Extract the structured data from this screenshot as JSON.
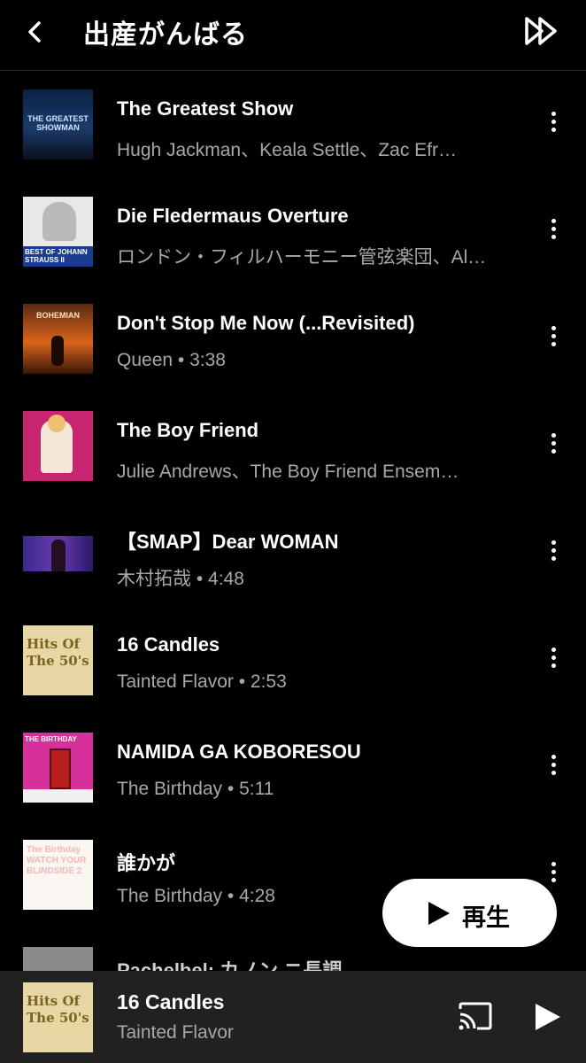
{
  "header": {
    "title": "出産がんばる",
    "back_icon": "chevron-left-icon",
    "skip_icon": "skip-forward-icon"
  },
  "tracks": [
    {
      "title": "The Greatest Show",
      "subtitle": "Hugh Jackman、Keala Settle、Zac Efr…",
      "thumb_text": "THE GREATEST SHOWMAN"
    },
    {
      "title": "Die Fledermaus Overture",
      "subtitle": "ロンドン・フィルハーモニー管弦楽団、Al…",
      "thumb_text": "BEST OF JOHANN STRAUSS II"
    },
    {
      "title": "Don't Stop Me Now (...Revisited)",
      "subtitle": "Queen • 3:38",
      "thumb_text": "BOHEMIAN"
    },
    {
      "title": "The Boy Friend",
      "subtitle": "Julie Andrews、The Boy Friend Ensem…",
      "thumb_text": ""
    },
    {
      "title": "【SMAP】Dear WOMAN",
      "subtitle": "木村拓哉 • 4:48",
      "thumb_text": ""
    },
    {
      "title": "16 Candles",
      "subtitle": "Tainted Flavor • 2:53",
      "thumb_text": "Hits Of The 50's"
    },
    {
      "title": "NAMIDA GA KOBORESOU",
      "subtitle": "The Birthday • 5:11",
      "thumb_text": "THE BIRTHDAY"
    },
    {
      "title": "誰かが",
      "subtitle": "The Birthday • 4:28",
      "thumb_text": "The Birthday WATCH YOUR BLINDSIDE 2"
    },
    {
      "title": "Pachelbel: カノン ニ長調",
      "subtitle": "",
      "thumb_text": ""
    }
  ],
  "play_button": {
    "label": "再生",
    "icon": "play-icon"
  },
  "now_playing": {
    "title": "16 Candles",
    "artist": "Tainted Flavor",
    "thumb_text": "Hits Of The 50's",
    "cast_icon": "cast-icon",
    "play_icon": "play-icon"
  },
  "colors": {
    "background": "#000000",
    "subtext": "#a8a8a8",
    "mini_player_bg": "#212121"
  }
}
